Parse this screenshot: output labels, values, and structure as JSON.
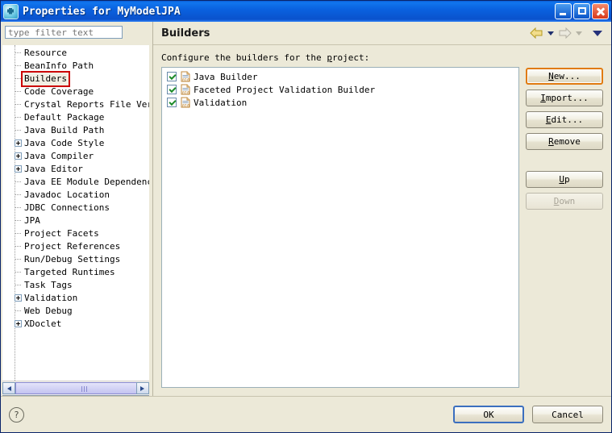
{
  "window": {
    "title": "Properties for MyModelJPA",
    "icon": "eclipse-properties-icon",
    "buttons": {
      "minimize": "minimize-button",
      "maximize": "maximize-button",
      "close": "close-button"
    }
  },
  "sidebar": {
    "filter": {
      "value": "",
      "placeholder": "type filter text"
    },
    "items": [
      {
        "label": "Resource",
        "expandable": false,
        "selected": false
      },
      {
        "label": "BeanInfo Path",
        "expandable": false,
        "selected": false
      },
      {
        "label": "Builders",
        "expandable": false,
        "selected": true
      },
      {
        "label": "Code Coverage",
        "expandable": false,
        "selected": false
      },
      {
        "label": "Crystal Reports File Vers",
        "expandable": false,
        "selected": false
      },
      {
        "label": "Default Package",
        "expandable": false,
        "selected": false
      },
      {
        "label": "Java Build Path",
        "expandable": false,
        "selected": false
      },
      {
        "label": "Java Code Style",
        "expandable": true,
        "selected": false
      },
      {
        "label": "Java Compiler",
        "expandable": true,
        "selected": false
      },
      {
        "label": "Java Editor",
        "expandable": true,
        "selected": false
      },
      {
        "label": "Java EE Module Dependenci",
        "expandable": false,
        "selected": false
      },
      {
        "label": "Javadoc Location",
        "expandable": false,
        "selected": false
      },
      {
        "label": "JDBC Connections",
        "expandable": false,
        "selected": false
      },
      {
        "label": "JPA",
        "expandable": false,
        "selected": false
      },
      {
        "label": "Project Facets",
        "expandable": false,
        "selected": false
      },
      {
        "label": "Project References",
        "expandable": false,
        "selected": false
      },
      {
        "label": "Run/Debug Settings",
        "expandable": false,
        "selected": false
      },
      {
        "label": "Targeted Runtimes",
        "expandable": false,
        "selected": false
      },
      {
        "label": "Task Tags",
        "expandable": false,
        "selected": false
      },
      {
        "label": "Validation",
        "expandable": true,
        "selected": false
      },
      {
        "label": "Web Debug",
        "expandable": false,
        "selected": false
      },
      {
        "label": "XDoclet",
        "expandable": true,
        "selected": false
      }
    ],
    "scrollbar": {
      "left_arrow": "scroll-left-arrow",
      "right_arrow": "scroll-right-arrow"
    },
    "selection_highlight_color": "#cc0000"
  },
  "page": {
    "title": "Builders",
    "description": "Configure the builders for the project:",
    "nav": {
      "back": "back-arrow",
      "back_menu": "back-dropdown",
      "forward": "forward-arrow",
      "forward_menu": "forward-dropdown",
      "menu": "view-menu-chevron"
    },
    "builders": [
      {
        "name": "Java Builder",
        "checked": true,
        "icon": "builder-file-icon"
      },
      {
        "name": "Faceted Project Validation Builder",
        "checked": true,
        "icon": "builder-file-icon"
      },
      {
        "name": "Validation",
        "checked": true,
        "icon": "builder-file-icon"
      }
    ],
    "buttons": [
      {
        "label": "New...",
        "mnemonic": "N",
        "enabled": true,
        "focused": true
      },
      {
        "label": "Import...",
        "mnemonic": "I",
        "enabled": true,
        "focused": false
      },
      {
        "label": "Edit...",
        "mnemonic": "E",
        "enabled": true,
        "focused": false
      },
      {
        "label": "Remove",
        "mnemonic": "R",
        "enabled": true,
        "focused": false
      },
      {
        "label": "Up",
        "mnemonic": "U",
        "enabled": true,
        "focused": false
      },
      {
        "label": "Down",
        "mnemonic": "D",
        "enabled": false,
        "focused": false
      }
    ]
  },
  "footer": {
    "help": "?",
    "ok": "OK",
    "cancel": "Cancel"
  }
}
